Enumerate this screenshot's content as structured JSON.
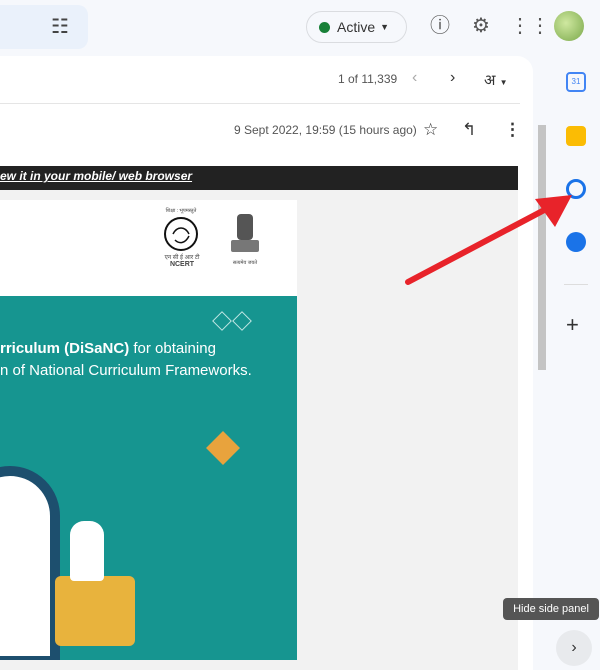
{
  "header": {
    "status_label": "Active",
    "icons": [
      "filter-icon",
      "help-icon",
      "settings-icon",
      "apps-icon",
      "avatar"
    ]
  },
  "toolbar": {
    "pager": "1 of 11,339",
    "language": "अ"
  },
  "message": {
    "date": "9 Sept 2022, 19:59 (15 hours ago)",
    "banner_link": "ew it in your mobile/ web browser",
    "ncert_top": "शिक्षा : भूपमस्तुते",
    "ncert_hindi": "एन सी ई आर टी",
    "ncert_label": "NCERT",
    "emblem_caption": "सत्यमेव जयते",
    "headline_bold": "rriculum (DiSaNC)",
    "headline_rest": " for obtaining",
    "headline_line2": "n of National Curriculum Frameworks."
  },
  "side_panel": {
    "apps": [
      "calendar-icon",
      "keep-icon",
      "tasks-icon",
      "contacts-icon"
    ],
    "add": "+",
    "tooltip": "Hide side panel",
    "calendar_day": "31"
  },
  "colors": {
    "teal": "#169590",
    "active": "#188038",
    "arrow": "#e8232a"
  }
}
